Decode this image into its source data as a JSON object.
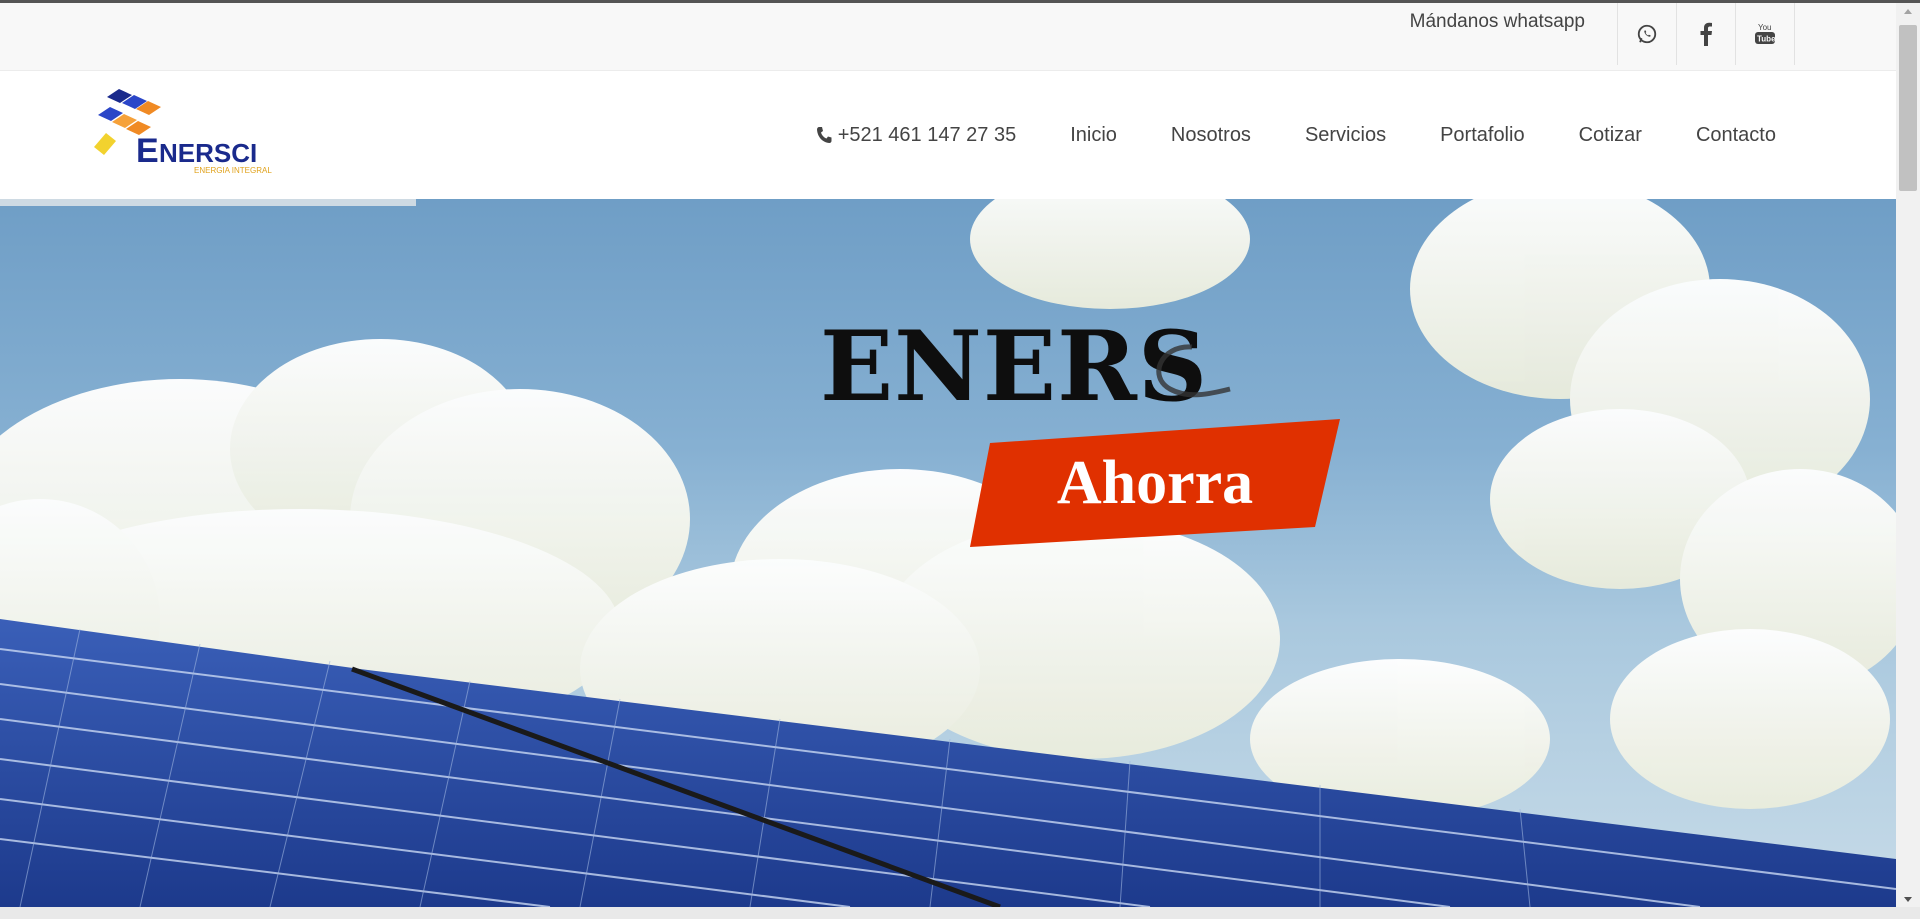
{
  "topbar": {
    "whatsapp_label": "Mándanos whatsapp",
    "social": [
      {
        "icon": "whatsapp-icon"
      },
      {
        "icon": "facebook-icon"
      },
      {
        "icon": "youtube-icon"
      }
    ]
  },
  "logo": {
    "name": "ENERSCI",
    "tagline": "ENERGIA INTEGRAL"
  },
  "nav": {
    "phone": "+521 461 147 27 35",
    "items": [
      "Inicio",
      "Nosotros",
      "Servicios",
      "Portafolio",
      "Cotizar",
      "Contacto"
    ]
  },
  "hero": {
    "title": "ENERS",
    "badge": "Ahorra"
  },
  "colors": {
    "accent": "#e03000",
    "logo_blue": "#1a2a8c",
    "logo_orange": "#f08a24",
    "logo_yellow": "#f2d22e"
  }
}
